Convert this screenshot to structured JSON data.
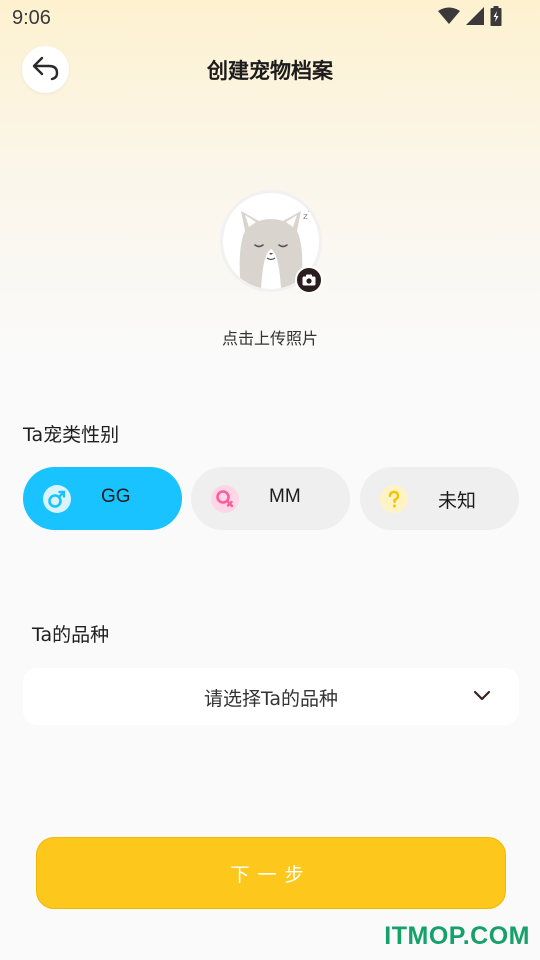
{
  "status_bar": {
    "time": "9:06"
  },
  "header": {
    "title": "创建宠物档案"
  },
  "avatar": {
    "upload_label": "点击上传照片"
  },
  "gender": {
    "label": "Ta宠类性别",
    "options": [
      {
        "label": "GG",
        "selected": true
      },
      {
        "label": "MM",
        "selected": false
      },
      {
        "label": "未知",
        "selected": false
      }
    ]
  },
  "breed": {
    "label": "Ta的品种",
    "placeholder": "请选择Ta的品种"
  },
  "footer": {
    "next_label": "下一步"
  },
  "watermark": "ITMOP.COM",
  "colors": {
    "accent_blue": "#19c3ff",
    "accent_yellow": "#fdc71c",
    "female_pink": "#ff5c9a",
    "unknown_yellow": "#f5c400"
  }
}
